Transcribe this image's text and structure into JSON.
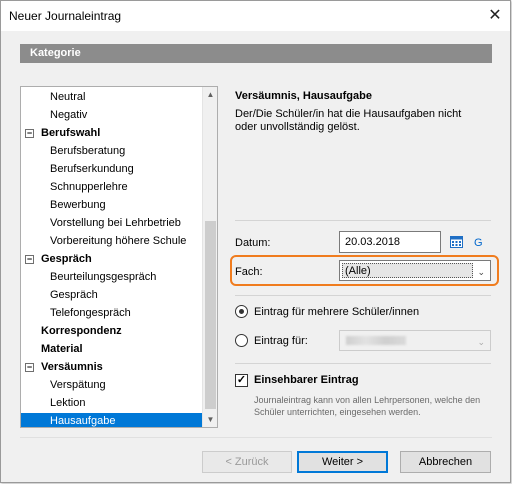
{
  "window": {
    "title": "Neuer Journaleintrag",
    "close_glyph": "✕"
  },
  "category": {
    "header": "Kategorie",
    "items": [
      {
        "label": "Neutral",
        "level": "child"
      },
      {
        "label": "Negativ",
        "level": "child"
      },
      {
        "label": "Berufswahl",
        "level": "parent",
        "expanded": true
      },
      {
        "label": "Berufsberatung",
        "level": "child"
      },
      {
        "label": "Berufserkundung",
        "level": "child"
      },
      {
        "label": "Schnupperlehre",
        "level": "child"
      },
      {
        "label": "Bewerbung",
        "level": "child"
      },
      {
        "label": "Vorstellung bei Lehrbetrieb",
        "level": "child"
      },
      {
        "label": "Vorbereitung höhere Schule",
        "level": "child"
      },
      {
        "label": "Gespräch",
        "level": "parent",
        "expanded": true
      },
      {
        "label": "Beurteilungsgespräch",
        "level": "child"
      },
      {
        "label": "Gespräch",
        "level": "child"
      },
      {
        "label": "Telefongespräch",
        "level": "child"
      },
      {
        "label": "Korrespondenz",
        "level": "leaf-bold"
      },
      {
        "label": "Material",
        "level": "leaf-bold"
      },
      {
        "label": "Versäumnis",
        "level": "parent",
        "expanded": true
      },
      {
        "label": "Verspätung",
        "level": "child"
      },
      {
        "label": "Lektion",
        "level": "child"
      },
      {
        "label": "Hausaufgabe",
        "level": "child",
        "selected": true
      }
    ],
    "expander_glyph": "−"
  },
  "info": {
    "title": "Versäumnis, Hausaufgabe",
    "description": "Der/Die Schüler/in hat die Hausaufgaben nicht oder unvollständig gelöst."
  },
  "form": {
    "date_label": "Datum:",
    "date_value": "20.03.2018",
    "g_label": "G",
    "subject_label": "Fach:",
    "subject_value": "(Alle)",
    "radio_multi_label": "Eintrag für mehrere Schüler/innen",
    "radio_single_label": "Eintrag für:",
    "checkbox_label": "Einsehbarer Eintrag",
    "checkbox_checked": true,
    "checkbox_description": "Journaleintrag kann von allen Lehrpersonen, welche den Schüler unterrichten, eingesehen werden."
  },
  "buttons": {
    "back": "< Zurück",
    "next": "Weiter >",
    "cancel": "Abbrechen"
  },
  "colors": {
    "selection": "#0078d7",
    "highlight": "#f07c1e",
    "header_bg": "#8c8c8c"
  }
}
